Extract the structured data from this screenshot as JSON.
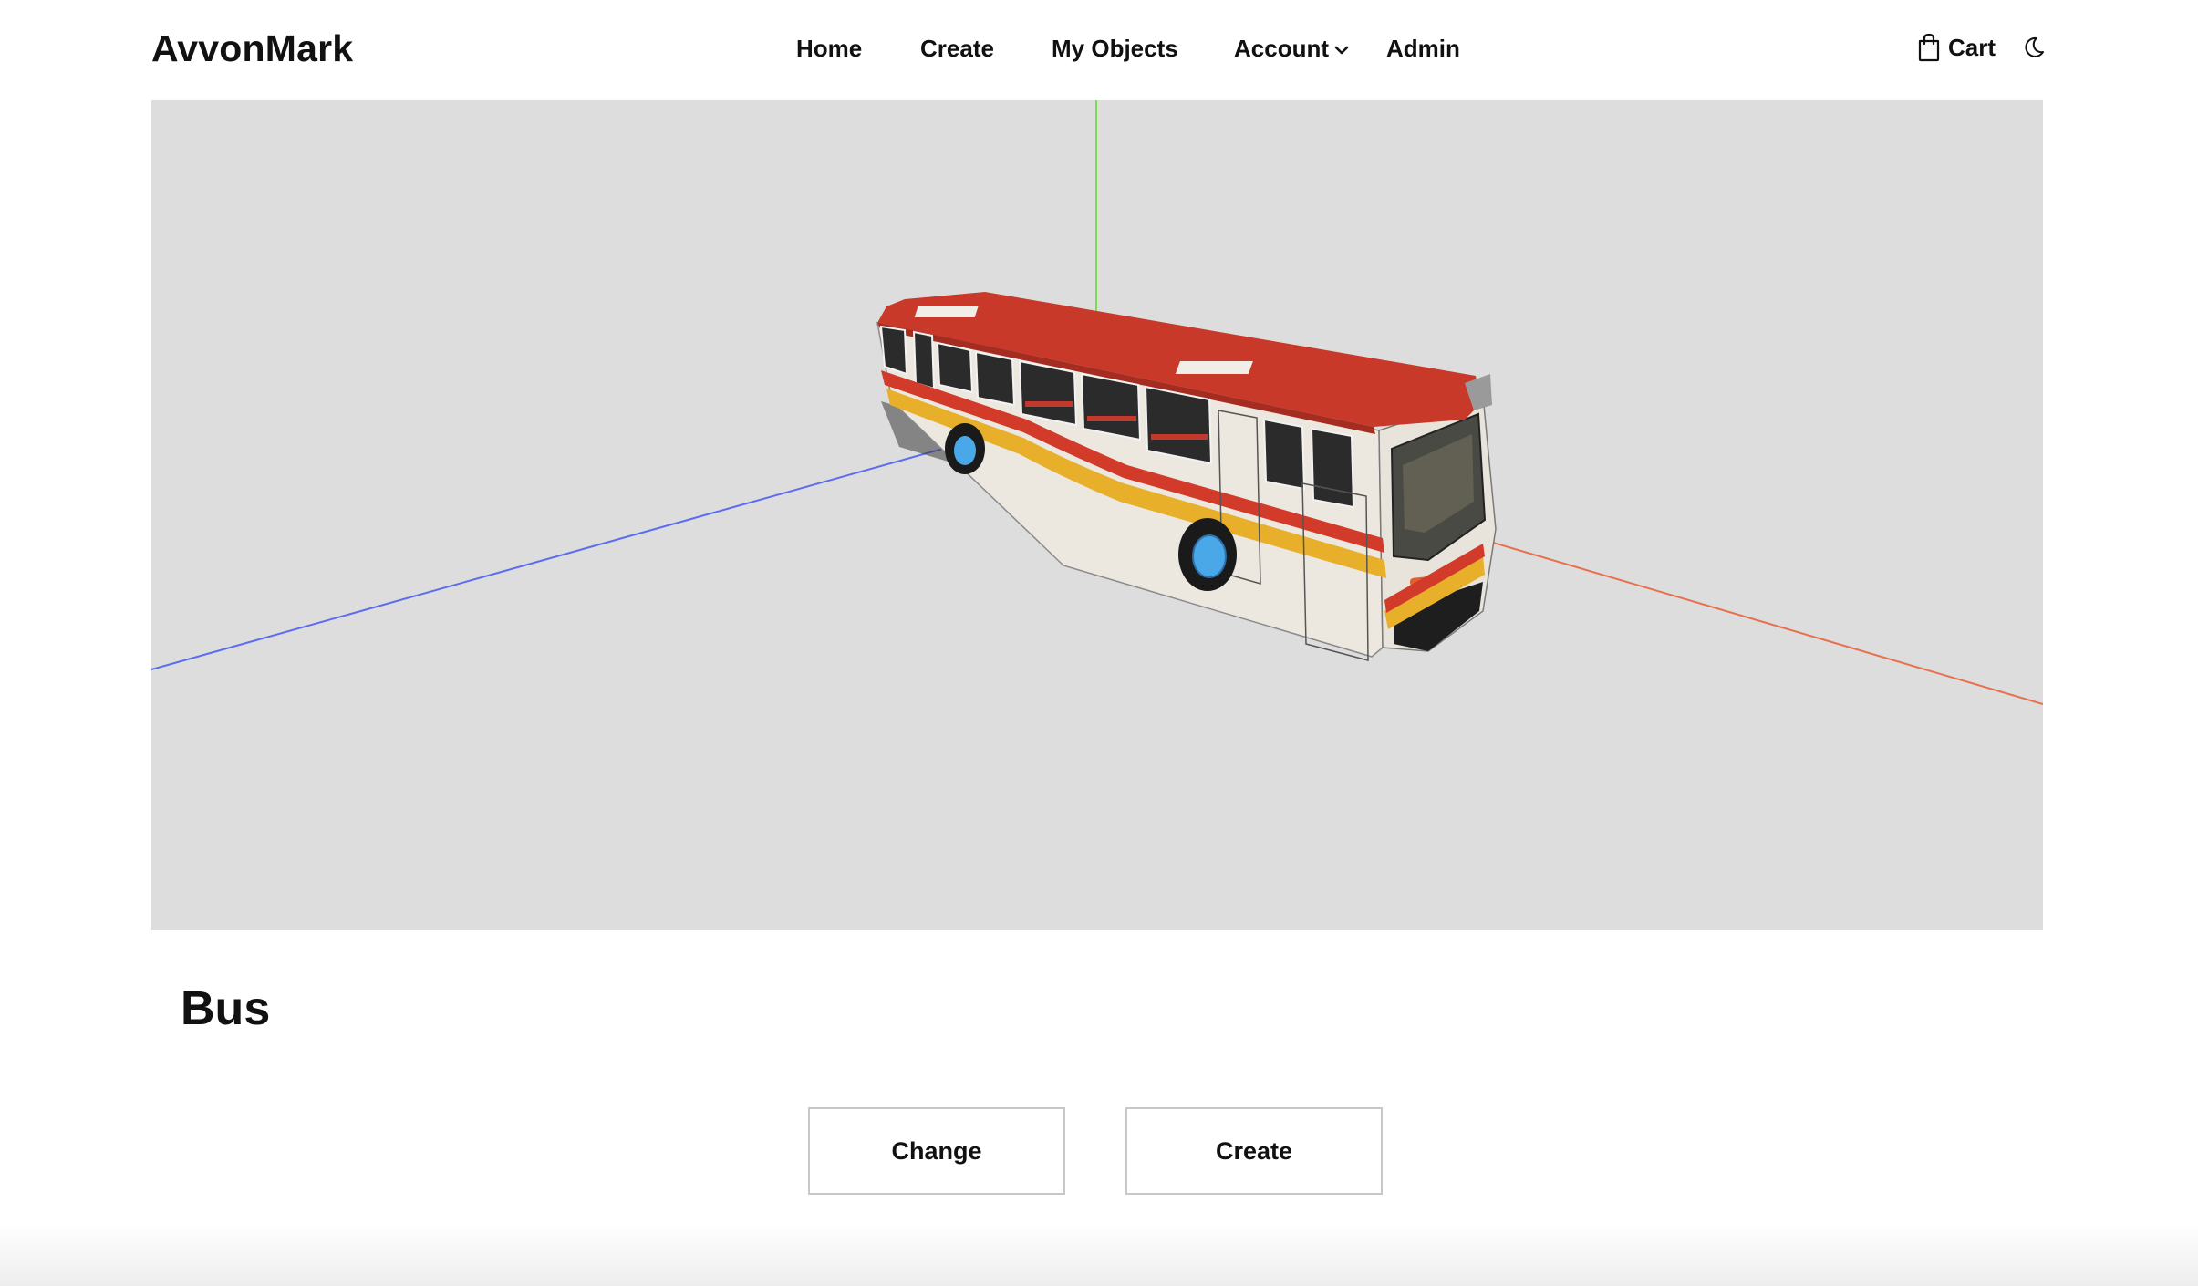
{
  "header": {
    "brand": "AvvonMark",
    "nav": {
      "home": "Home",
      "create": "Create",
      "my_objects": "My Objects",
      "account": "Account",
      "admin": "Admin"
    },
    "cart_label": "Cart",
    "icons": {
      "account_caret": "chevron-down-icon",
      "cart": "shopping-bag-icon",
      "theme": "moon-icon"
    }
  },
  "viewer": {
    "model": "bus",
    "background_color": "#dddddd",
    "axis_colors": {
      "x": "#e8704d",
      "y": "#7ed957",
      "z": "#5b6cf0"
    },
    "bus_colors": {
      "roof": "#c9392a",
      "body": "#ece8e0",
      "stripe_red": "#d23a2a",
      "stripe_yellow": "#e8b02a",
      "wheel_hub": "#4aa8e8"
    }
  },
  "object": {
    "title": "Bus"
  },
  "actions": {
    "change_label": "Change",
    "create_label": "Create"
  }
}
